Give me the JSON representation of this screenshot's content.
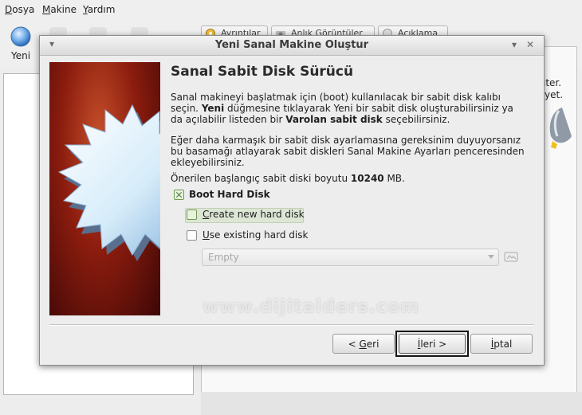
{
  "menubar": {
    "items": [
      {
        "label": "Dosya",
        "mnemonic": "D",
        "rest": "osya"
      },
      {
        "label": "Makine",
        "mnemonic": "M",
        "rest": "akine"
      },
      {
        "label": "Yardım",
        "mnemonic": "Y",
        "rest": "ardım"
      }
    ]
  },
  "toolbar": {
    "new_label": "Yeni"
  },
  "tabs": [
    {
      "label": "Ayrıntılar"
    },
    {
      "label": "Anlık Görüntüler"
    },
    {
      "label": "Açıklama"
    }
  ],
  "background_text": {
    "line1": "ıter.",
    "line2": "yet."
  },
  "dialog": {
    "title": "Yeni Sanal Makine Oluştur",
    "heading": "Sanal Sabit Disk Sürücü",
    "intro": {
      "part1": "Sanal makineyi başlatmak için (boot) kullanılacak bir sabit disk kalıbı seçin.",
      "yeni": "Yeni",
      "part2": " düğmesine tıklayarak Yeni bir sabit disk oluşturabilirsiniz ya da açılabilir listeden bir ",
      "varolan": "Varolan sabit disk",
      "part3": " seçebilirsiniz."
    },
    "advanced": "Eğer daha karmaşık bir sabit disk ayarlamasına gereksinim duyuyorsanız bu basamağı atlayarak sabit diskleri Sanal Makine Ayarları penceresinden ekleyebilirsiniz.",
    "recommended": {
      "prefix": "Önerilen başlangıç sabit diski boyutu ",
      "size": "10240",
      "unit": " MB."
    },
    "boot_checkbox": {
      "label": "Boot Hard Disk",
      "checked": true
    },
    "create_option": {
      "label": "Create new hard disk",
      "mnemonic": "C",
      "rest": "reate new hard disk",
      "selected": true
    },
    "existing_option": {
      "label": "Use existing hard disk",
      "mnemonic": "U",
      "rest": "se existing hard disk",
      "selected": false
    },
    "disk_combo": {
      "value": "Empty"
    },
    "watermark": "www.dijitalders.com",
    "buttons": {
      "back": {
        "label": "< Geri",
        "pre": "< ",
        "mnemonic": "G",
        "rest": "eri"
      },
      "next": {
        "label": "İleri >",
        "mnemonic": "İ",
        "rest": "leri >"
      },
      "cancel": {
        "label": "İptal",
        "mnemonic": "İ",
        "rest": "ptal"
      }
    }
  },
  "colors": {
    "wizard_red": "#8b1c0e",
    "star": "#d8ecf8",
    "accent_green": "#6f9a4f"
  }
}
